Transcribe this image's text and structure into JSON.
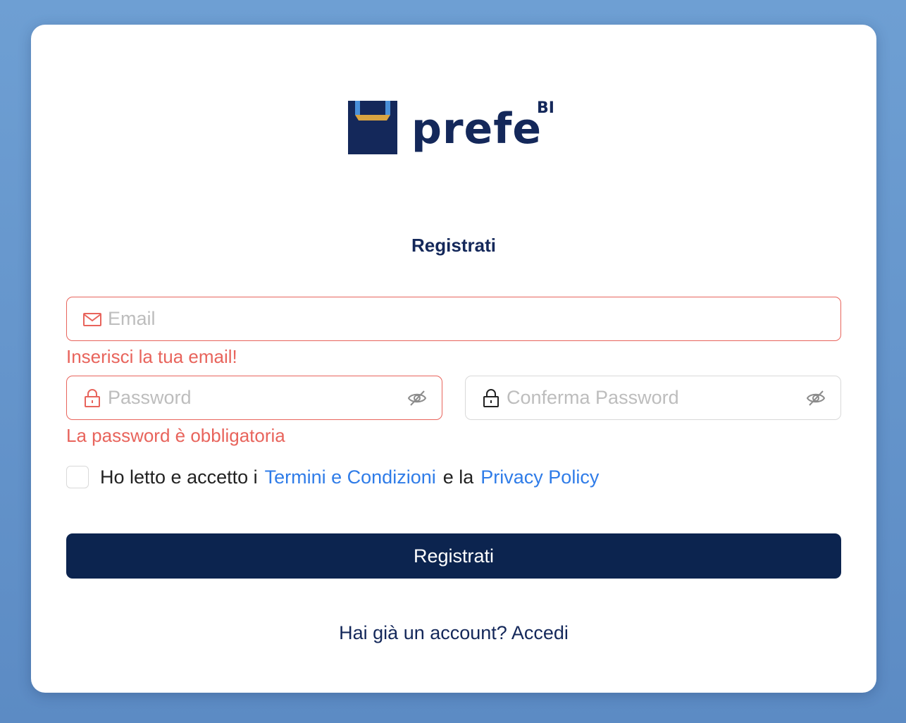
{
  "brand": {
    "name": "prefe",
    "superscript": "BI",
    "colors": {
      "navy": "#14285a",
      "blue": "#4a90d9",
      "gold": "#d9a441"
    }
  },
  "form": {
    "title": "Registrati",
    "email": {
      "placeholder": "Email",
      "value": "",
      "error": "Inserisci la tua email!"
    },
    "password": {
      "placeholder": "Password",
      "value": "",
      "error": "La password è obbligatoria"
    },
    "confirm_password": {
      "placeholder": "Conferma Password",
      "value": ""
    },
    "terms": {
      "checked": false,
      "prefix": "Ho letto e accetto i",
      "terms_link": "Termini e Condizioni",
      "middle": "e la",
      "privacy_link": "Privacy Policy"
    },
    "submit_label": "Registrati",
    "login_prompt": "Hai già un account? Accedi"
  },
  "colors": {
    "error": "#e8645c",
    "link": "#2f7ce8",
    "button_bg": "#0c244f",
    "border": "#d9d9d9"
  },
  "icons": {
    "email": "mail-icon",
    "password": "lock-icon",
    "confirm_password": "lock-icon",
    "toggle": "eye-off-icon"
  }
}
